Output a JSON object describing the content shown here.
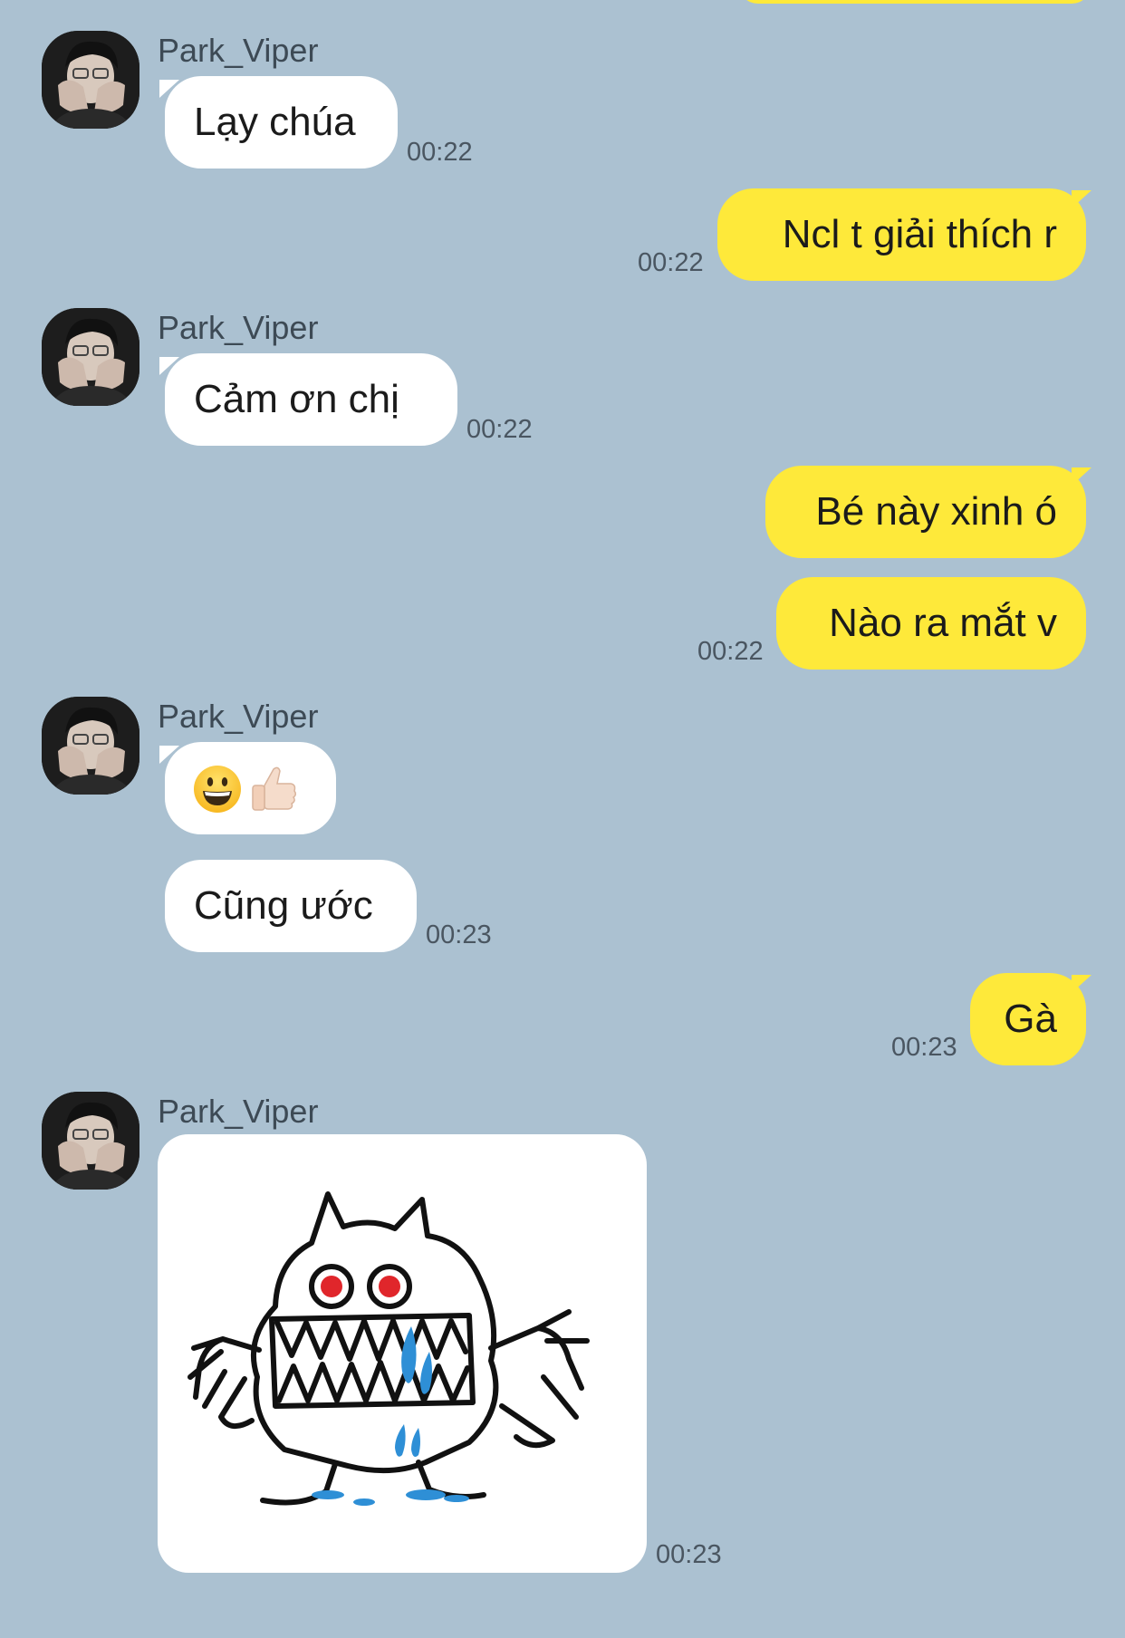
{
  "messages": [
    {
      "type": "incoming",
      "sender": "Park_Viper",
      "text": "Lạy chúa",
      "time": "00:22"
    },
    {
      "type": "outgoing",
      "text": "Ncl t giải thích r",
      "time": "00:22"
    },
    {
      "type": "incoming",
      "sender": "Park_Viper",
      "text": "Cảm ơn chị",
      "time": "00:22"
    },
    {
      "type": "outgoing",
      "text": "Bé này xinh ó"
    },
    {
      "type": "outgoing",
      "text": "Nào ra mắt v",
      "time": "00:22"
    },
    {
      "type": "incoming",
      "sender": "Park_Viper",
      "text": "😀👍🏻"
    },
    {
      "type": "incoming",
      "text": "Cũng ước",
      "time": "00:23"
    },
    {
      "type": "outgoing",
      "text": "Gà",
      "time": "00:23"
    },
    {
      "type": "incoming-sticker",
      "sender": "Park_Viper",
      "sticker_icon": "crying-monster-sticker",
      "time": "00:23"
    }
  ],
  "colors": {
    "background": "#abc1d1",
    "incoming_bubble": "#ffffff",
    "outgoing_bubble": "#fee93a"
  },
  "icons": [
    "avatar",
    "grinning-face-emoji",
    "thumbs-up-emoji",
    "crying-monster-sticker"
  ]
}
